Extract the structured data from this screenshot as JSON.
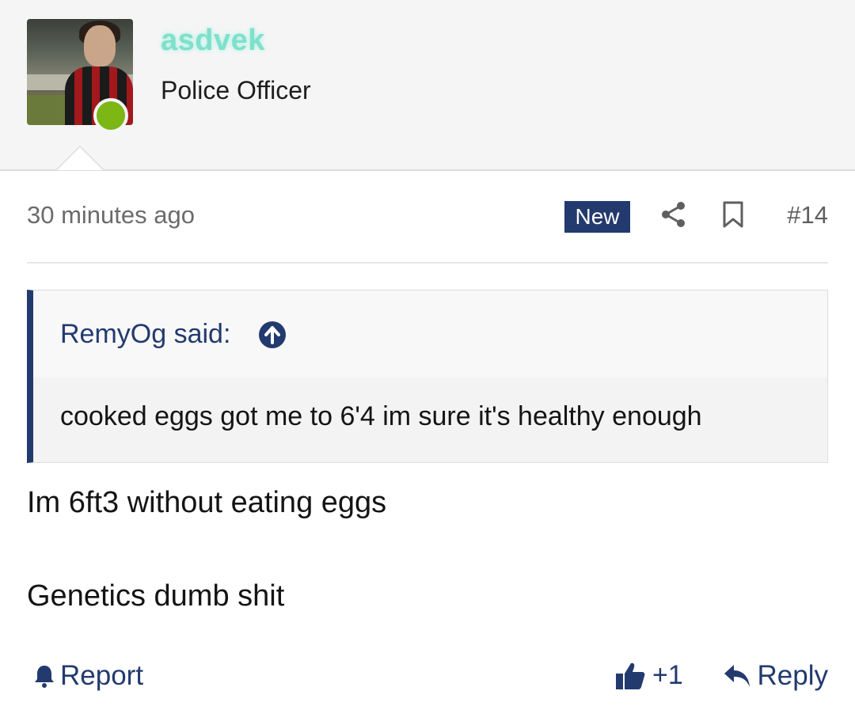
{
  "user": {
    "username": "asdvek",
    "title": "Police Officer",
    "status": "online",
    "username_color": "#7fe0cc"
  },
  "post": {
    "timestamp": "30 minutes ago",
    "badge": "New",
    "number": "#14",
    "quote": {
      "author": "RemyOg said:",
      "text": "cooked eggs got me to 6'4 im sure it's healthy enough"
    },
    "message": [
      "Im 6ft3 without eating eggs",
      "Genetics dumb shit"
    ]
  },
  "actions": {
    "report": "Report",
    "reaction_count": "+1",
    "reply": "Reply"
  },
  "icons": {
    "share": "share-icon",
    "bookmark": "bookmark-icon",
    "quote_jump": "arrow-up-circle-icon",
    "report": "bell-icon",
    "reaction": "thumbs-up-icon",
    "reply": "reply-arrow-icon"
  },
  "colors": {
    "accent": "#233a6e",
    "online": "#7cb716",
    "header_bg": "#f5f5f5"
  }
}
